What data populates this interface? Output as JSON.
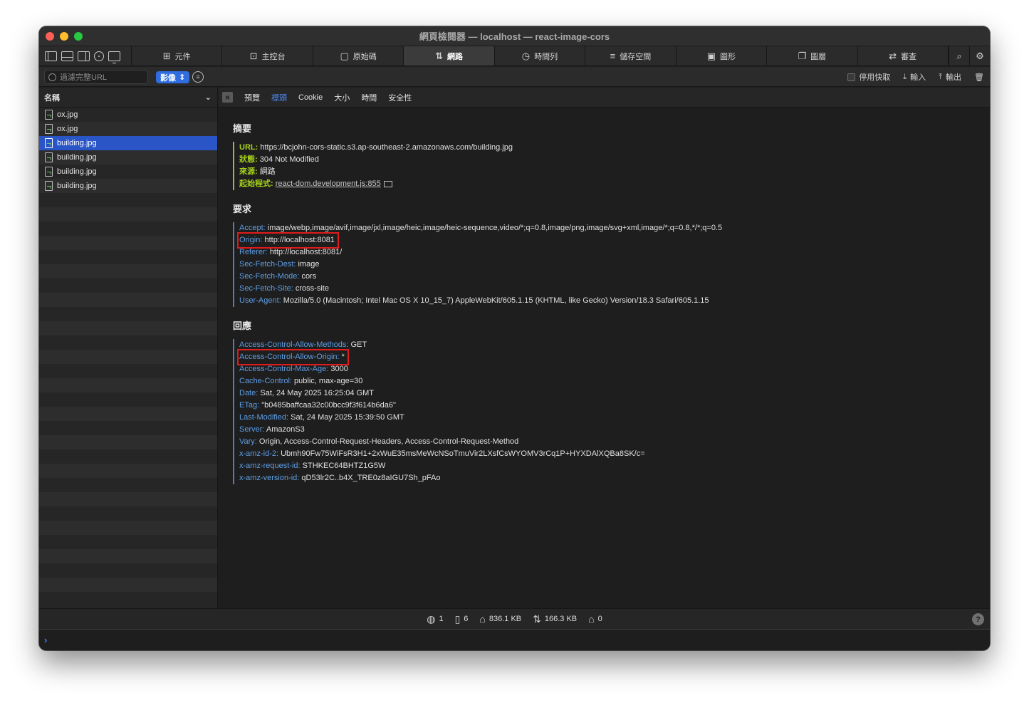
{
  "window": {
    "title": "網頁檢閱器 — localhost — react-image-cors"
  },
  "tabs": [
    {
      "label": "元件",
      "icon": "elements-icon",
      "glyph": "⊞",
      "active": false
    },
    {
      "label": "主控台",
      "icon": "console-icon",
      "glyph": "⊡",
      "active": false
    },
    {
      "label": "原始碼",
      "icon": "sources-icon",
      "glyph": "▢",
      "active": false
    },
    {
      "label": "網路",
      "icon": "network-icon",
      "glyph": "⇅",
      "active": true
    },
    {
      "label": "時間列",
      "icon": "timelines-icon",
      "glyph": "◷",
      "active": false
    },
    {
      "label": "儲存空間",
      "icon": "storage-icon",
      "glyph": "≡",
      "active": false
    },
    {
      "label": "圖形",
      "icon": "graphics-icon",
      "glyph": "▣",
      "active": false
    },
    {
      "label": "圖層",
      "icon": "layers-icon",
      "glyph": "❐",
      "active": false
    },
    {
      "label": "審查",
      "icon": "audit-icon",
      "glyph": "⇄",
      "active": false
    }
  ],
  "filterbar": {
    "filter_placeholder": "過濾完整URL",
    "type_select": "影像",
    "disable_cache_label": "停用快取",
    "import_label": "輸入",
    "export_label": "輸出"
  },
  "sidebar": {
    "header": "名稱",
    "items": [
      {
        "name": "ox.jpg",
        "selected": false
      },
      {
        "name": "ox.jpg",
        "selected": false
      },
      {
        "name": "building.jpg",
        "selected": true
      },
      {
        "name": "building.jpg",
        "selected": false
      },
      {
        "name": "building.jpg",
        "selected": false
      },
      {
        "name": "building.jpg",
        "selected": false
      }
    ]
  },
  "detail_tabs": [
    {
      "label": "預覽",
      "active": false
    },
    {
      "label": "標頭",
      "active": true
    },
    {
      "label": "Cookie",
      "active": false
    },
    {
      "label": "大小",
      "active": false
    },
    {
      "label": "時間",
      "active": false
    },
    {
      "label": "安全性",
      "active": false
    }
  ],
  "summary": {
    "title": "摘要",
    "url_key": "URL:",
    "url_val": "https://bcjohn-cors-static.s3.ap-southeast-2.amazonaws.com/building.jpg",
    "status_key": "狀態:",
    "status_val": "304 Not Modified",
    "source_key": "來源:",
    "source_val": "網路",
    "initiator_key": "起始程式:",
    "initiator_val": "react-dom.development.js:855"
  },
  "request": {
    "title": "要求",
    "headers": [
      {
        "k": "Accept:",
        "v": "image/webp,image/avif,image/jxl,image/heic,image/heic-sequence,video/*;q=0.8,image/png,image/svg+xml,image/*;q=0.8,*/*;q=0.5",
        "highlight": false
      },
      {
        "k": "Origin:",
        "v": "http://localhost:8081",
        "highlight": true
      },
      {
        "k": "Referer:",
        "v": "http://localhost:8081/",
        "highlight": false
      },
      {
        "k": "Sec-Fetch-Dest:",
        "v": "image",
        "highlight": false
      },
      {
        "k": "Sec-Fetch-Mode:",
        "v": "cors",
        "highlight": false
      },
      {
        "k": "Sec-Fetch-Site:",
        "v": "cross-site",
        "highlight": false
      },
      {
        "k": "User-Agent:",
        "v": "Mozilla/5.0 (Macintosh; Intel Mac OS X 10_15_7) AppleWebKit/605.1.15 (KHTML, like Gecko) Version/18.3 Safari/605.1.15",
        "highlight": false
      }
    ]
  },
  "response": {
    "title": "回應",
    "headers": [
      {
        "k": "Access-Control-Allow-Methods:",
        "v": "GET",
        "highlight": false
      },
      {
        "k": "Access-Control-Allow-Origin:",
        "v": "*",
        "highlight": true
      },
      {
        "k": "Access-Control-Max-Age:",
        "v": "3000",
        "highlight": false
      },
      {
        "k": "Cache-Control:",
        "v": "public, max-age=30",
        "highlight": false
      },
      {
        "k": "Date:",
        "v": "Sat, 24 May 2025 16:25:04 GMT",
        "highlight": false
      },
      {
        "k": "ETag:",
        "v": "\"b0485baffcaa32c00bcc9f3f614b6da6\"",
        "highlight": false
      },
      {
        "k": "Last-Modified:",
        "v": "Sat, 24 May 2025 15:39:50 GMT",
        "highlight": false
      },
      {
        "k": "Server:",
        "v": "AmazonS3",
        "highlight": false
      },
      {
        "k": "Vary:",
        "v": "Origin, Access-Control-Request-Headers, Access-Control-Request-Method",
        "highlight": false
      },
      {
        "k": "x-amz-id-2:",
        "v": "Ubmh90Fw75WiFsR3H1+2xWuE35msMeWcNSoTmuVir2LXsfCsWYOMV3rCq1P+HYXDAlXQBa8SK/c=",
        "highlight": false
      },
      {
        "k": "x-amz-request-id:",
        "v": "STHKEC64BHTZ1G5W",
        "highlight": false
      },
      {
        "k": "x-amz-version-id:",
        "v": "qD53lr2C..b4X_TRE0z8aIGU7Sh_pFAo",
        "highlight": false
      }
    ]
  },
  "status": {
    "domains": "1",
    "resources": "6",
    "transferred": "836.1 KB",
    "resources_size": "166.3 KB",
    "errors": "0"
  },
  "colors": {
    "accent": "#2f6de1",
    "selection": "#2a55c7",
    "summary_key": "#a6d21a",
    "header_key": "#5e9ee6",
    "highlight_box": "#e01b1b"
  }
}
